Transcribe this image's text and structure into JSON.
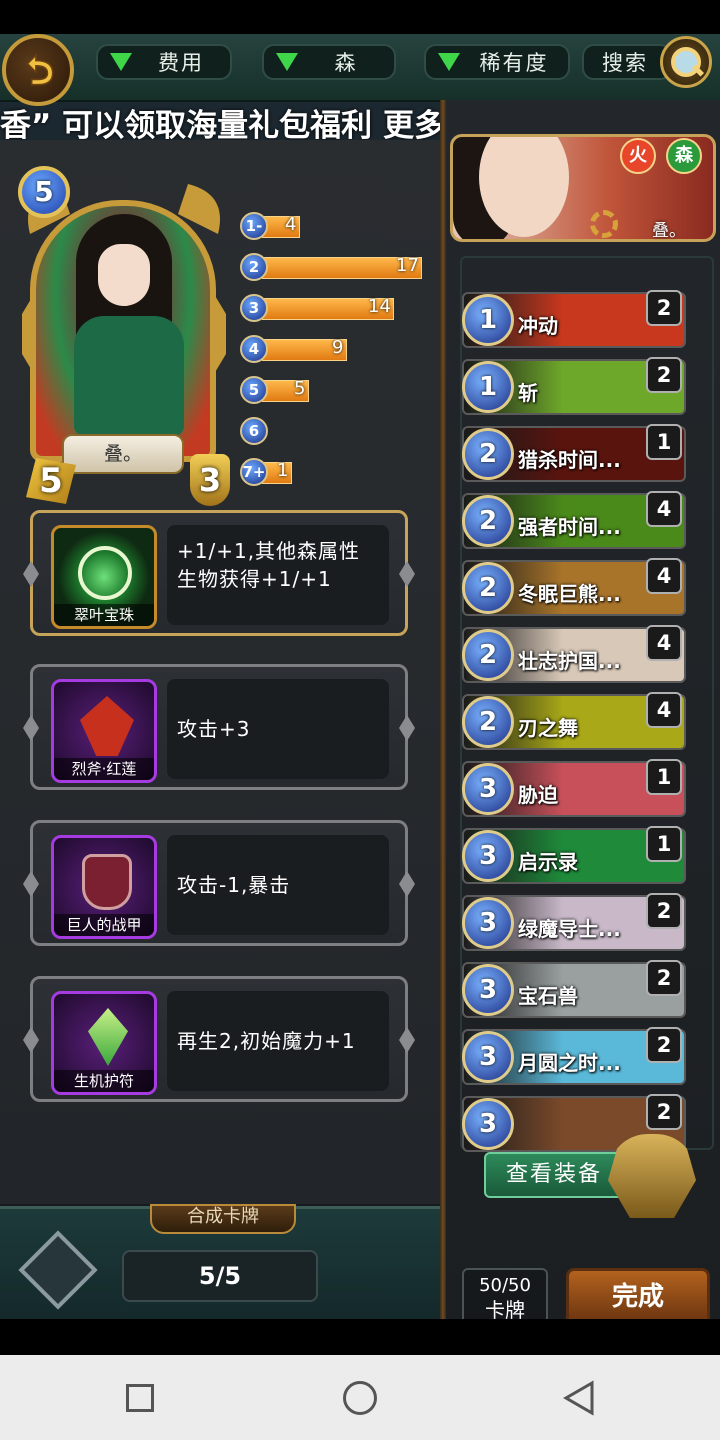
{
  "topbar": {
    "filters": [
      {
        "label": "费用"
      },
      {
        "label": "森"
      },
      {
        "label": "稀有度"
      }
    ],
    "search_label": "搜索"
  },
  "marquee": "香” 可以领取海量礼包福利 更多福利资讯 卡",
  "hero": {
    "name": "叠。",
    "cost": "5",
    "attack": "5",
    "health": "3"
  },
  "mana_curve": [
    {
      "cost": "1-",
      "count": 4
    },
    {
      "cost": "2",
      "count": 17
    },
    {
      "cost": "3",
      "count": 14
    },
    {
      "cost": "4",
      "count": 9
    },
    {
      "cost": "5",
      "count": 5
    },
    {
      "cost": "6",
      "count": 0
    },
    {
      "cost": "7+",
      "count": 1
    }
  ],
  "equipment": [
    {
      "name": "翠叶宝珠",
      "desc": "+1/+1,其他森属性生物获得+1/+1"
    },
    {
      "name": "烈斧·红莲",
      "desc": "攻击+3"
    },
    {
      "name": "巨人的战甲",
      "desc": "攻击-1,暴击"
    },
    {
      "name": "生机护符",
      "desc": "再生2,初始魔力+1"
    }
  ],
  "bottom": {
    "merge_label": "合成卡牌",
    "count": "5/5"
  },
  "banner": {
    "elements": [
      "火",
      "森"
    ],
    "name": "叠。"
  },
  "deck": [
    {
      "cost": "1",
      "name": "冲动",
      "count": "2",
      "color": "#c8381e"
    },
    {
      "cost": "1",
      "name": "斩",
      "count": "2",
      "color": "#6ea82a"
    },
    {
      "cost": "2",
      "name": "猎杀时间...",
      "count": "1",
      "color": "#5a140e"
    },
    {
      "cost": "2",
      "name": "强者时间...",
      "count": "4",
      "color": "#4a8a1a"
    },
    {
      "cost": "2",
      "name": "冬眠巨熊...",
      "count": "4",
      "color": "#a8742a"
    },
    {
      "cost": "2",
      "name": "壮志护国...",
      "count": "4",
      "color": "#d8c8b8"
    },
    {
      "cost": "2",
      "name": "刃之舞",
      "count": "4",
      "color": "#a8a818"
    },
    {
      "cost": "3",
      "name": "胁迫",
      "count": "1",
      "color": "#c8505a"
    },
    {
      "cost": "3",
      "name": "启示录",
      "count": "1",
      "color": "#1e8a3a"
    },
    {
      "cost": "3",
      "name": "绿魔导士...",
      "count": "2",
      "color": "#c8b8c8"
    },
    {
      "cost": "3",
      "name": "宝石兽",
      "count": "2",
      "color": "#9aa0a0"
    },
    {
      "cost": "3",
      "name": "月圆之时...",
      "count": "2",
      "color": "#5ab8d8"
    },
    {
      "cost": "3",
      "name": "",
      "count": "2",
      "color": "#7a4a2a"
    }
  ],
  "view_equip_label": "查看装备",
  "deck_total": {
    "value": "50/50",
    "label": "卡牌"
  },
  "done_label": "完成",
  "colors": {
    "accent_gold": "#c6a55a",
    "bar_orange": "#e07a12",
    "mana_blue": "#1c2f86",
    "forest_green": "#3fd64a"
  }
}
